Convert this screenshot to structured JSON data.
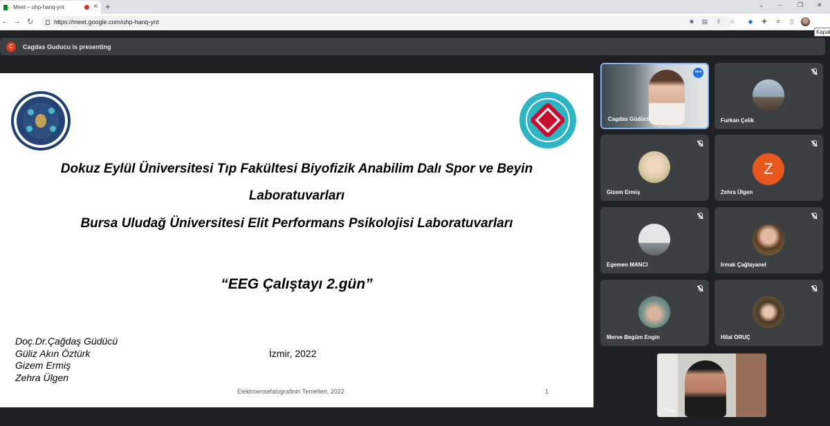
{
  "browser": {
    "tab_title": "Meet – uhp-hanq-ynt",
    "tab_close": "✕",
    "new_tab": "+",
    "url": "https://meet.google.com/uhp-hanq-ynt",
    "tooltip": "Kapat",
    "window_controls": [
      "⌄",
      "–",
      "❐",
      "✕"
    ]
  },
  "meet": {
    "presenter_initial": "C",
    "presenting_text": "Cagdas Guducu is presenting",
    "slide": {
      "title_line1": "Dokuz Eylül Üniversitesi Tıp Fakültesi Biyofizik Anabilim Dalı Spor ve Beyin",
      "title_line2": "Laboratuvarları",
      "title_line3": "Bursa Uludağ Üniversitesi Elit Performans Psikolojisi Laboratuvarları",
      "subtitle": "“EEG Çalıştayı 2.gün”",
      "authors": [
        "Doç.Dr.Çağdaş Güdücü",
        "Güliz Akın Öztürk",
        "Gizem Ermiş",
        "Zehra Ülgen"
      ],
      "city_year": "İzmir, 2022",
      "footer": "Elektroensefalografinin Temelleri, 2022",
      "page_number": "1"
    },
    "participants": [
      {
        "name": "Cagdas Güdücü",
        "type": "video"
      },
      {
        "name": "Furkan Çelik",
        "type": "photo",
        "color": "#8fa3b5"
      },
      {
        "name": "Gizem Ermiş",
        "type": "photo",
        "color": "#d7c9a2"
      },
      {
        "name": "Zehra Ülgen",
        "type": "letter",
        "letter": "Z",
        "color": "#e8571e"
      },
      {
        "name": "Egemen MANCI",
        "type": "photo",
        "color": "#a9b3b7"
      },
      {
        "name": "Irmak Çağlayanel",
        "type": "photo",
        "color": "#6b5a3f"
      },
      {
        "name": "Merve Begüm Engin",
        "type": "photo",
        "color": "#6f8f8a"
      },
      {
        "name": "Hilal ORUÇ",
        "type": "photo",
        "color": "#7a6a3c"
      }
    ],
    "self_label": "You"
  }
}
